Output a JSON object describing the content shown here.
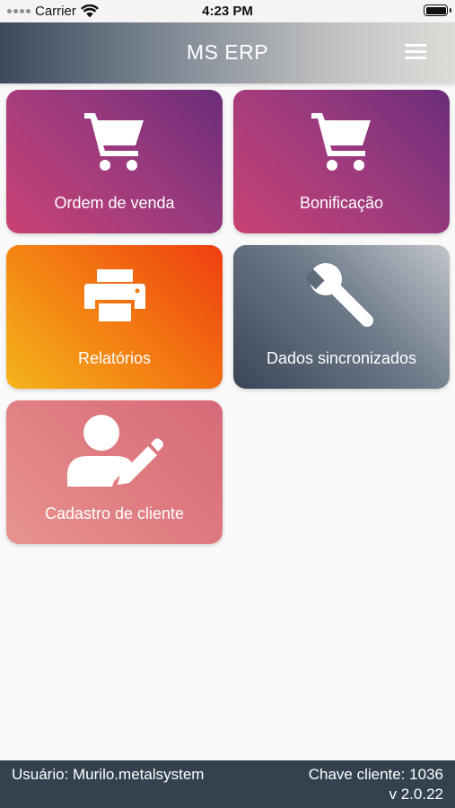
{
  "status_bar": {
    "carrier": "Carrier",
    "time": "4:23 PM",
    "icons": [
      "signal-dots-icon",
      "wifi-icon",
      "battery-icon"
    ]
  },
  "header": {
    "title": "MS ERP",
    "menu_icon": "hamburger-menu-icon",
    "gradient": [
      "#3c4a5b",
      "#dedcd8"
    ]
  },
  "tiles": [
    {
      "label": "Ordem de venda",
      "icon": "cart-icon",
      "colors": [
        "#c94274",
        "#6b2d78"
      ]
    },
    {
      "label": "Bonificação",
      "icon": "cart-icon",
      "colors": [
        "#c94274",
        "#6b2d78"
      ]
    },
    {
      "label": "Relatórios",
      "icon": "printer-icon",
      "colors": [
        "#f5b41b",
        "#ee3e10"
      ]
    },
    {
      "label": "Dados sincronizados",
      "icon": "wrench-icon",
      "colors": [
        "#3a4557",
        "#c2c6cc"
      ]
    },
    {
      "label": "Cadastro de cliente",
      "icon": "user-edit-icon",
      "colors": [
        "#e8948f",
        "#d66b79"
      ]
    }
  ],
  "footer": {
    "user": "Usuário: Murilo.metalsystem",
    "client_key": "Chave cliente: 1036",
    "version": "v 2.0.22",
    "background": "#34424f"
  }
}
